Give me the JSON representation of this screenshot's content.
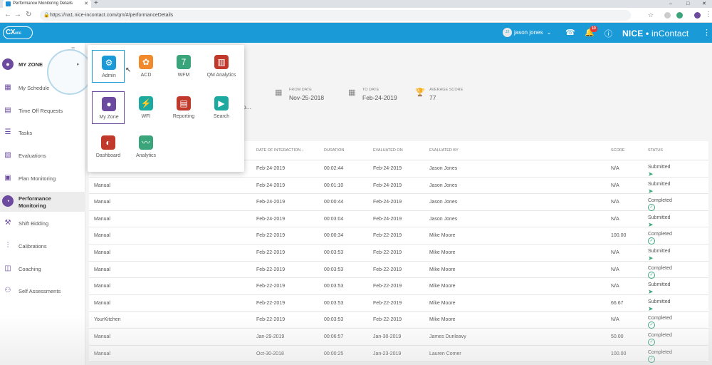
{
  "browser": {
    "tab_title": "Performance Monitoring Details",
    "url": "https://na1.nice-incontact.com/qm/#/performanceDetails"
  },
  "header": {
    "logo_main": "CX",
    "logo_sub": "one",
    "user_initials": "JJ",
    "user_name": "jason jones",
    "notification_count": "10",
    "brand_nice": "NICE",
    "brand_incontact": "inContact"
  },
  "sidebar": {
    "items": [
      {
        "label": "MY ZONE",
        "icon": "my-zone-icon"
      },
      {
        "label": "My Schedule",
        "icon": "schedule-icon"
      },
      {
        "label": "Time Off Requests",
        "icon": "time-off-icon"
      },
      {
        "label": "Tasks",
        "icon": "tasks-icon"
      },
      {
        "label": "Evaluations",
        "icon": "evaluations-icon"
      },
      {
        "label": "Plan Monitoring",
        "icon": "plan-monitoring-icon"
      },
      {
        "label": "Performance Monitoring",
        "icon": "performance-icon"
      },
      {
        "label": "Shift Bidding",
        "icon": "shift-bidding-icon"
      },
      {
        "label": "Calibrations",
        "icon": "calibrations-icon"
      },
      {
        "label": "Coaching",
        "icon": "coaching-icon"
      },
      {
        "label": "Self Assessments",
        "icon": "self-assessments-icon"
      }
    ]
  },
  "app_menu": {
    "tiles": [
      {
        "label": "Admin",
        "icon": "admin-icon",
        "color": "#1b9ad8"
      },
      {
        "label": "ACD",
        "icon": "acd-icon",
        "color": "#f08a2c"
      },
      {
        "label": "WFM",
        "icon": "wfm-icon",
        "color": "#3aa57a"
      },
      {
        "label": "QM Analytics",
        "icon": "qm-analytics-icon",
        "color": "#c0392b"
      },
      {
        "label": "My Zone",
        "icon": "my-zone-icon",
        "color": "#6b4aa0"
      },
      {
        "label": "WFI",
        "icon": "wfi-icon",
        "color": "#1ba9a0"
      },
      {
        "label": "Reporting",
        "icon": "reporting-icon",
        "color": "#c0392b"
      },
      {
        "label": "Search",
        "icon": "search-icon",
        "color": "#1ba9a0"
      },
      {
        "label": "Dashboard",
        "icon": "dashboard-icon",
        "color": "#c0392b"
      },
      {
        "label": "Analytics",
        "icon": "analytics-icon",
        "color": "#3aa57a"
      }
    ]
  },
  "summary": {
    "partial_line1": "",
    "partial_line2": "p...",
    "from_date_label": "FROM DATE",
    "from_date": "Nov-25-2018",
    "to_date_label": "TO DATE",
    "to_date": "Feb-24-2019",
    "avg_score_label": "AVERAGE SCORE",
    "avg_score": "77"
  },
  "table": {
    "headers": [
      "DATE OF INTERACTION ↓",
      "DURATION",
      "EVALUATED ON",
      "EVALUATED BY",
      "SCORE",
      "STATUS"
    ],
    "rows": [
      {
        "type": "",
        "date": "Feb-24-2019",
        "duration": "00:02:44",
        "evaluated_on": "Feb-24-2019",
        "evaluated_by": "Jason Jones",
        "score": "N/A",
        "status": "Submitted"
      },
      {
        "type": "Manual",
        "date": "Feb-24-2019",
        "duration": "00:01:10",
        "evaluated_on": "Feb-24-2019",
        "evaluated_by": "Jason Jones",
        "score": "N/A",
        "status": "Submitted"
      },
      {
        "type": "Manual",
        "date": "Feb-24-2019",
        "duration": "00:00:44",
        "evaluated_on": "Feb-24-2019",
        "evaluated_by": "Jason Jones",
        "score": "N/A",
        "status": "Completed"
      },
      {
        "type": "Manual",
        "date": "Feb-24-2019",
        "duration": "00:03:04",
        "evaluated_on": "Feb-24-2019",
        "evaluated_by": "Jason Jones",
        "score": "N/A",
        "status": "Submitted"
      },
      {
        "type": "Manual",
        "date": "Feb-22-2019",
        "duration": "00:00:34",
        "evaluated_on": "Feb-22-2019",
        "evaluated_by": "Mike Moore",
        "score": "100.00",
        "status": "Completed"
      },
      {
        "type": "Manual",
        "date": "Feb-22-2019",
        "duration": "00:03:53",
        "evaluated_on": "Feb-22-2019",
        "evaluated_by": "Mike Moore",
        "score": "N/A",
        "status": "Submitted"
      },
      {
        "type": "Manual",
        "date": "Feb-22-2019",
        "duration": "00:03:53",
        "evaluated_on": "Feb-22-2019",
        "evaluated_by": "Mike Moore",
        "score": "N/A",
        "status": "Completed"
      },
      {
        "type": "Manual",
        "date": "Feb-22-2019",
        "duration": "00:03:53",
        "evaluated_on": "Feb-22-2019",
        "evaluated_by": "Mike Moore",
        "score": "N/A",
        "status": "Submitted"
      },
      {
        "type": "Manual",
        "date": "Feb-22-2019",
        "duration": "00:03:53",
        "evaluated_on": "Feb-22-2019",
        "evaluated_by": "Mike Moore",
        "score": "66.67",
        "status": "Submitted"
      },
      {
        "type": "YourKitchen",
        "date": "Feb-22-2019",
        "duration": "00:03:53",
        "evaluated_on": "Feb-22-2019",
        "evaluated_by": "Mike Moore",
        "score": "N/A",
        "status": "Completed"
      },
      {
        "type": "Manual",
        "date": "Jan-29-2019",
        "duration": "00:06:57",
        "evaluated_on": "Jan-30-2019",
        "evaluated_by": "James Dunleavy",
        "score": "50.00",
        "status": "Completed"
      },
      {
        "type": "Manual",
        "date": "Oct-30-2018",
        "duration": "00:00:25",
        "evaluated_on": "Jan-23-2019",
        "evaluated_by": "Lauren Comer",
        "score": "100.00",
        "status": "Completed"
      }
    ]
  }
}
